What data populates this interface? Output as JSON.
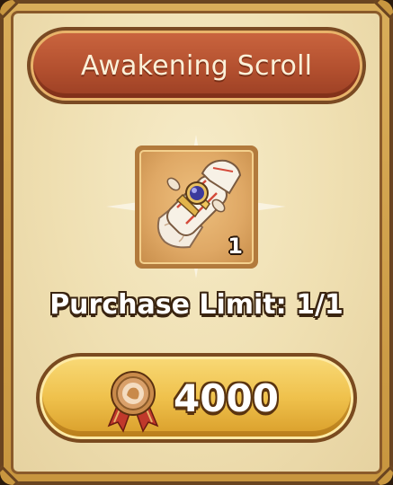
{
  "card": {
    "title": "Awakening Scroll",
    "item": {
      "icon": "awakening-scroll-icon",
      "count": "1"
    },
    "purchase_limit": "Purchase Limit: 1/1",
    "buy_button": {
      "currency_icon": "medal-currency-icon",
      "price": "4000"
    }
  },
  "colors": {
    "banner": "#b3502f",
    "card_border": "#c8963f",
    "card_background": "#efdfb1",
    "button": "#efc14c"
  }
}
